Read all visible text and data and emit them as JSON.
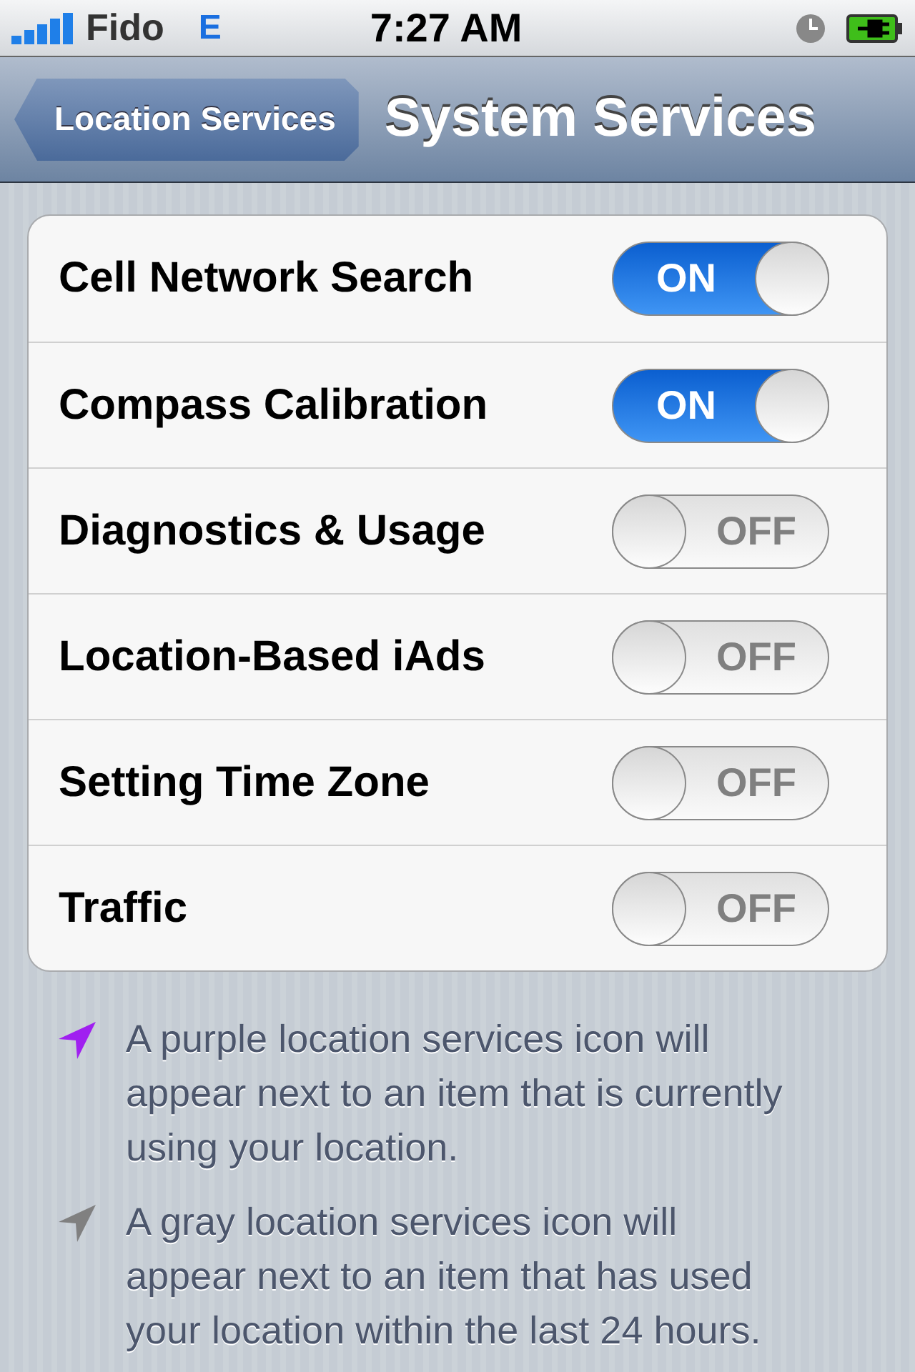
{
  "status_bar": {
    "carrier": "Fido",
    "network": "E",
    "time": "7:27 AM"
  },
  "nav_bar": {
    "back": "Location Services",
    "title": "System Services"
  },
  "settings": [
    {
      "label": "Cell Network Search",
      "on": true,
      "switch_text": "ON"
    },
    {
      "label": "Compass Calibration",
      "on": true,
      "switch_text": "ON"
    },
    {
      "label": "Diagnostics & Usage",
      "on": false,
      "switch_text": "OFF"
    },
    {
      "label": "Location-Based iAds",
      "on": false,
      "switch_text": "OFF"
    },
    {
      "label": "Setting Time Zone",
      "on": false,
      "switch_text": "OFF"
    },
    {
      "label": "Traffic",
      "on": false,
      "switch_text": "OFF"
    }
  ],
  "notes": [
    {
      "color": "#a020f0",
      "text": "A purple location services icon will appear next to an item that is currently using your location."
    },
    {
      "color": "#808080",
      "text": "A gray location services icon will appear next to an item that has used your location within the last 24 hours."
    }
  ]
}
